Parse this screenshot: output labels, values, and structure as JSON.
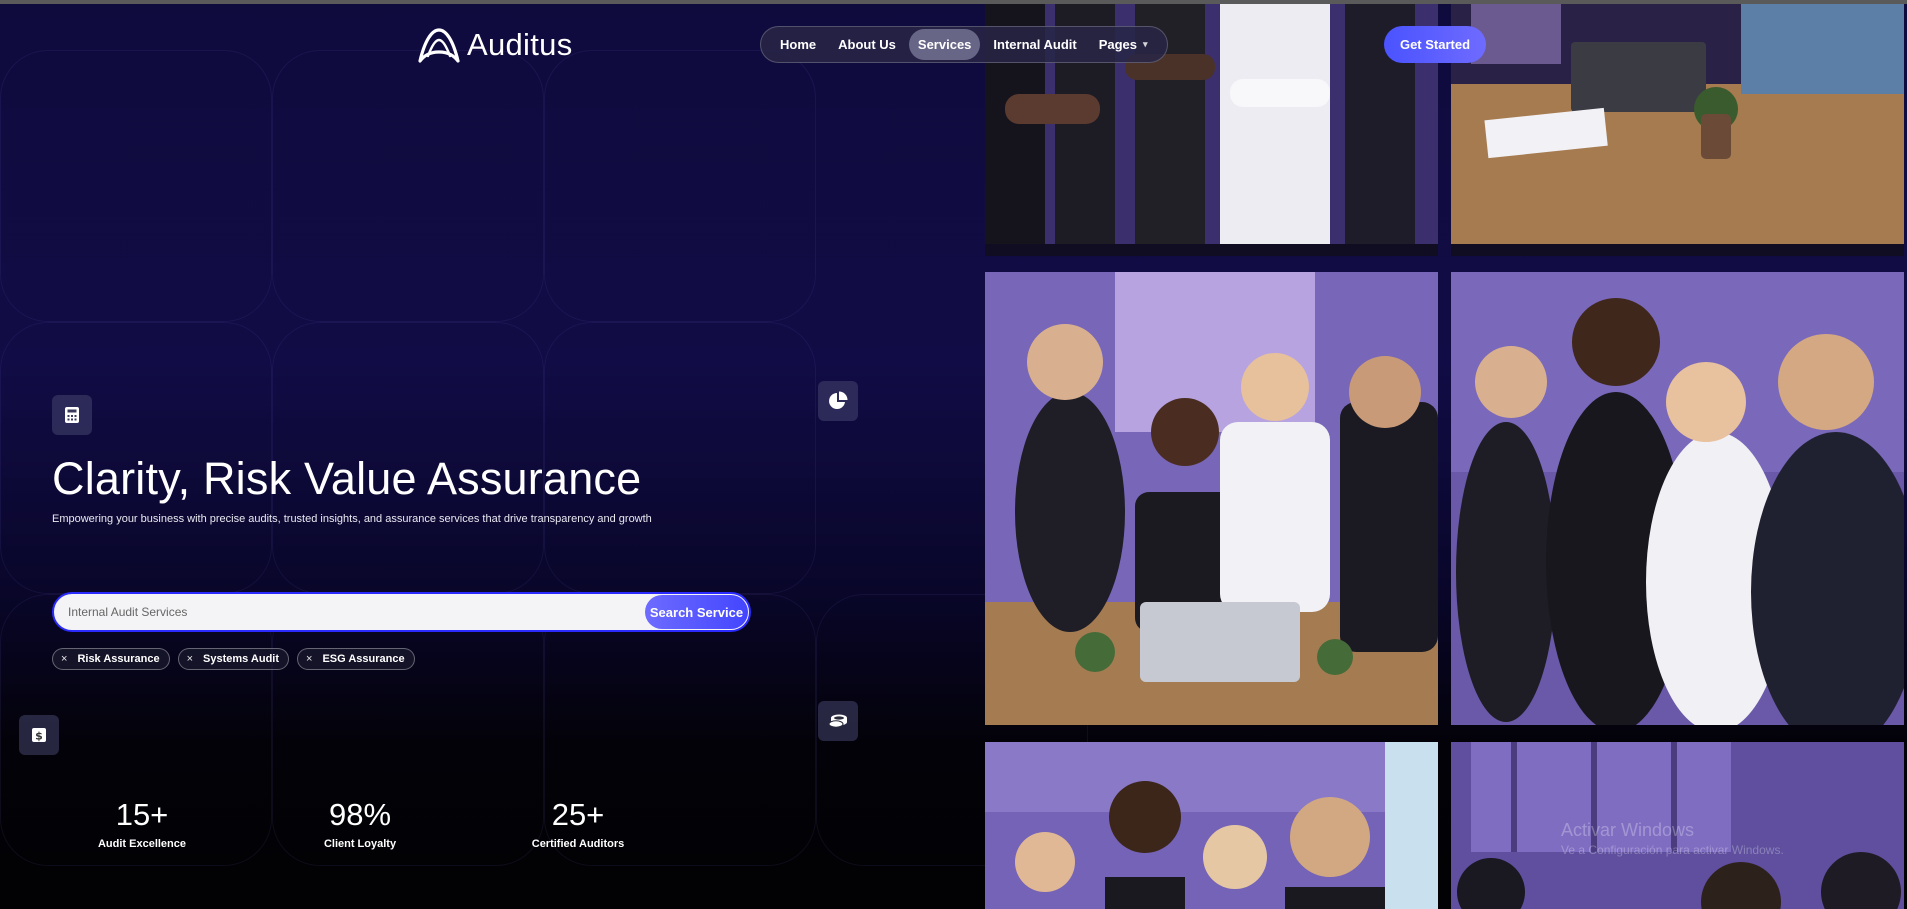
{
  "brand": {
    "name": "Auditus"
  },
  "nav": {
    "items": [
      {
        "label": "Home",
        "active": false
      },
      {
        "label": "About Us",
        "active": false
      },
      {
        "label": "Services",
        "active": true
      },
      {
        "label": "Internal Audit",
        "active": false
      },
      {
        "label": "Pages",
        "active": false,
        "has_dropdown": true
      }
    ],
    "cta_label": "Get Started"
  },
  "hero": {
    "title": "Clarity, Risk Value Assurance",
    "subtitle": "Empowering your business with precise audits, trusted insights, and assurance services that drive transparency and growth",
    "search": {
      "placeholder": "Internal Audit Services",
      "value": "",
      "button_label": "Search Service"
    },
    "chips": [
      {
        "label": "Risk Assurance"
      },
      {
        "label": "Systems Audit"
      },
      {
        "label": "ESG Assurance"
      }
    ],
    "chip_remove_glyph": "×"
  },
  "stats": [
    {
      "value": "15+",
      "label": "Audit Excellence"
    },
    {
      "value": "98%",
      "label": "Client Loyalty"
    },
    {
      "value": "25+",
      "label": "Certified Auditors"
    }
  ],
  "icons": {
    "top_left": "calculator-icon",
    "top_right": "pie-chart-icon",
    "bottom_left": "dollar-sign-icon",
    "bottom_right": "coins-icon",
    "chevron": "▾"
  },
  "photos": [
    {
      "name": "team-standing-arms-crossed"
    },
    {
      "name": "meeting-table-laptop"
    },
    {
      "name": "team-around-laptop"
    },
    {
      "name": "team-standing-side-view"
    },
    {
      "name": "team-portrait-front"
    },
    {
      "name": "team-portrait-right"
    }
  ],
  "watermark": {
    "line1": "Activar Windows",
    "line2": "Ve a Configuración para activar Windows."
  },
  "colors": {
    "background_top": "#110c45",
    "accent": "#4a53ff",
    "photo_tint": "#7c68d8"
  }
}
